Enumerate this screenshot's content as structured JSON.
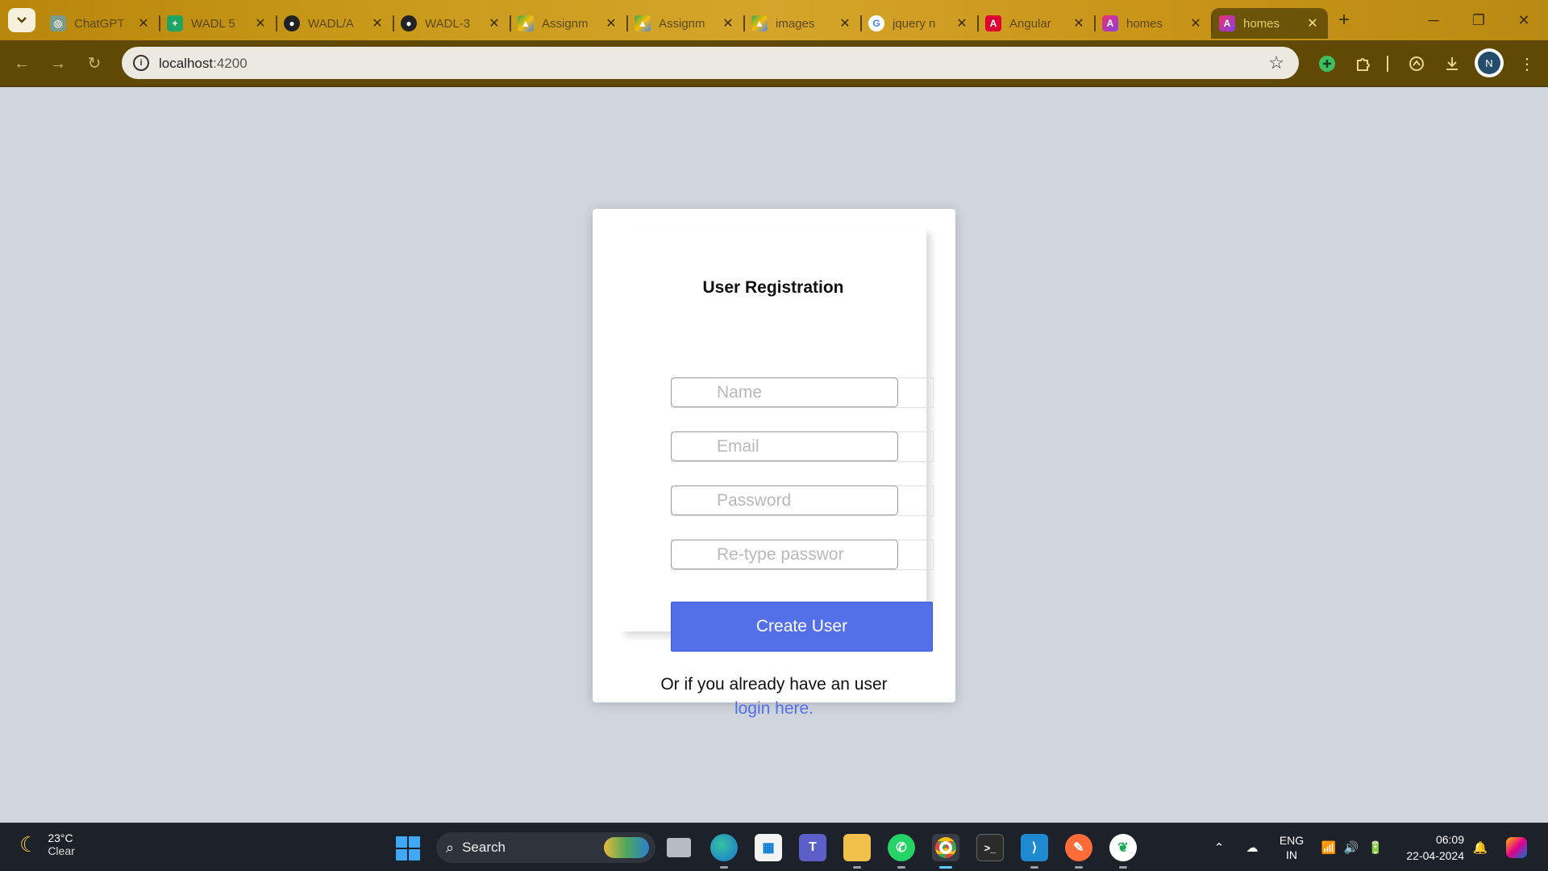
{
  "browser": {
    "tabs": [
      {
        "title": "ChatGPT",
        "icon": "chatgpt-icon",
        "active": false
      },
      {
        "title": "WADL 5",
        "icon": "sheets-icon",
        "active": false
      },
      {
        "title": "WADL/A",
        "icon": "github-icon",
        "active": false
      },
      {
        "title": "WADL-3",
        "icon": "github-icon",
        "active": false
      },
      {
        "title": "Assignm",
        "icon": "drive-icon",
        "active": false
      },
      {
        "title": "Assignm",
        "icon": "drive-icon",
        "active": false
      },
      {
        "title": "images",
        "icon": "drive-icon",
        "active": false
      },
      {
        "title": "jquery n",
        "icon": "google-icon",
        "active": false
      },
      {
        "title": "Angular",
        "icon": "angular-icon",
        "active": false
      },
      {
        "title": "homes",
        "icon": "angular-icon",
        "active": false
      },
      {
        "title": "homes",
        "icon": "angular-icon",
        "active": true
      }
    ],
    "url": {
      "host": "localhost",
      "port": ":4200"
    },
    "profile_initial": "N",
    "accent": "#5f4905"
  },
  "form": {
    "title": "User Registration",
    "fields": [
      {
        "placeholder": "Name",
        "value": ""
      },
      {
        "placeholder": "Email",
        "value": ""
      },
      {
        "placeholder": "Password",
        "value": ""
      },
      {
        "placeholder": "Re-type passwor",
        "value": ""
      }
    ],
    "submit_label": "Create User",
    "footer_text": "Or if you already have an user",
    "login_link": "login here.",
    "button_color": "#5470e8"
  },
  "taskbar": {
    "weather": {
      "temp": "23°C",
      "condition": "Clear"
    },
    "search_label": "Search",
    "language": {
      "line1": "ENG",
      "line2": "IN"
    },
    "time": "06:09",
    "date": "22-04-2024"
  }
}
